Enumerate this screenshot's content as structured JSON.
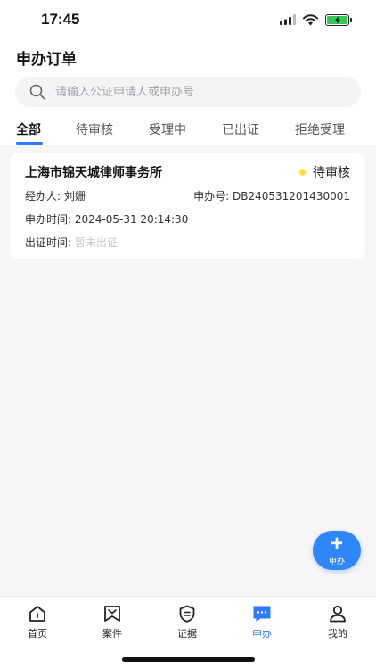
{
  "status_bar": {
    "time": "17:45"
  },
  "header": {
    "title": "申办订单"
  },
  "search": {
    "placeholder": "请输入公证申请人或申办号"
  },
  "tabs": [
    {
      "label": "全部",
      "active": true
    },
    {
      "label": "待审核",
      "active": false
    },
    {
      "label": "受理中",
      "active": false
    },
    {
      "label": "已出证",
      "active": false
    },
    {
      "label": "拒绝受理",
      "active": false
    }
  ],
  "order": {
    "title": "上海市锦天城律师事务所",
    "status": "待审核",
    "agent_label": "经办人:",
    "agent": "刘姗",
    "order_no_label": "申办号:",
    "order_no": "DB240531201430001",
    "apply_time_label": "申办时间:",
    "apply_time": "2024-05-31 20:14:30",
    "issue_time_label": "出证时间:",
    "issue_time": "暂未出证"
  },
  "fab": {
    "label": "申办"
  },
  "tabbar": [
    {
      "label": "首页",
      "icon": "home-icon"
    },
    {
      "label": "案件",
      "icon": "bookmark-icon"
    },
    {
      "label": "证据",
      "icon": "shield-icon"
    },
    {
      "label": "申办",
      "icon": "chat-icon",
      "active": true
    },
    {
      "label": "我的",
      "icon": "user-icon"
    }
  ],
  "colors": {
    "accent": "#2e7bff",
    "fab": "#2f86f6",
    "status_dot": "#ffdf3a"
  }
}
